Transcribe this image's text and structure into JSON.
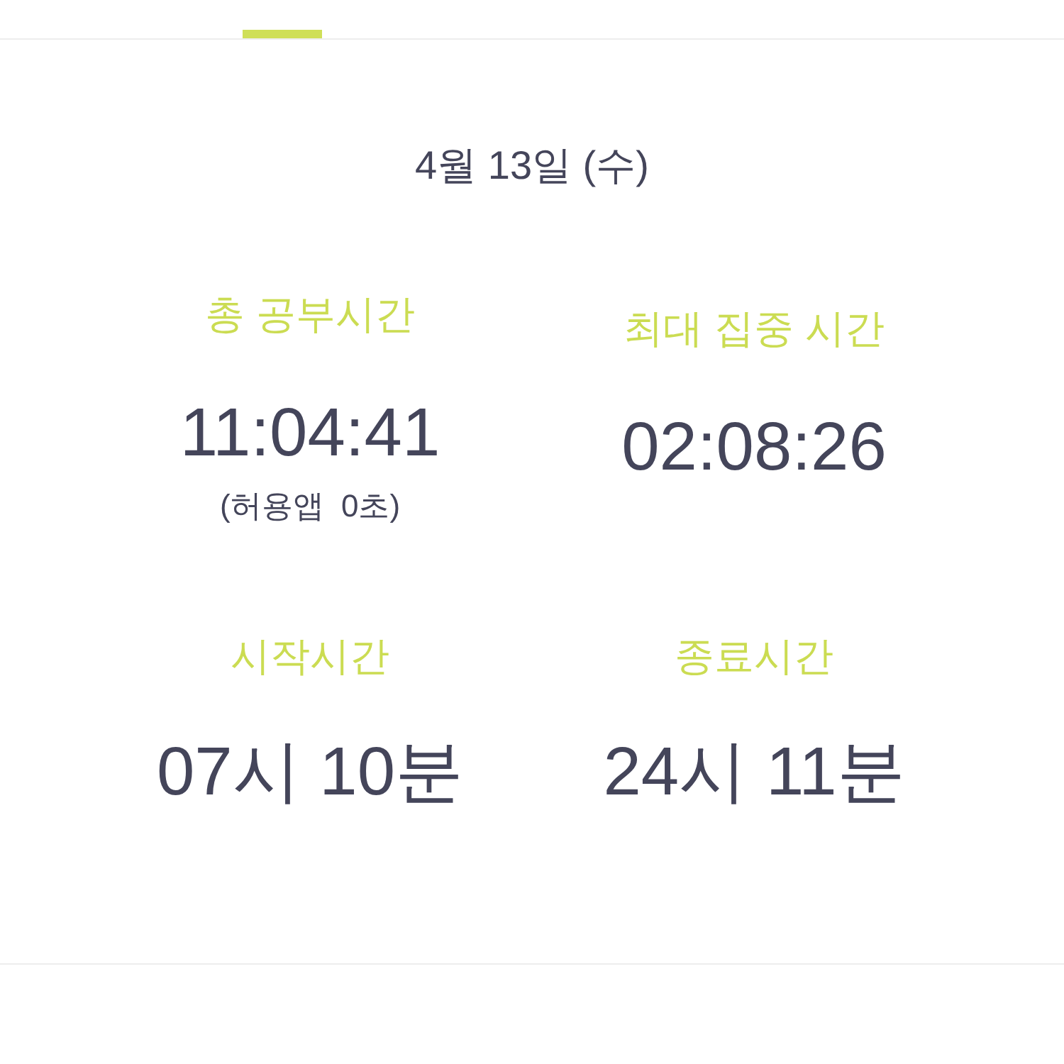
{
  "tab_bar": {
    "tabs": [
      {
        "selected": true
      }
    ]
  },
  "date": "4월 13일 (수)",
  "stats": [
    {
      "label": "총 공부시간",
      "value": "11:04:41",
      "note": "(허용앱  0초)"
    },
    {
      "label": "최대 집중 시간",
      "value": "02:08:26"
    },
    {
      "label": "시작시간",
      "value": "07시 10분"
    },
    {
      "label": "종료시간",
      "value": "24시 11분"
    }
  ]
}
